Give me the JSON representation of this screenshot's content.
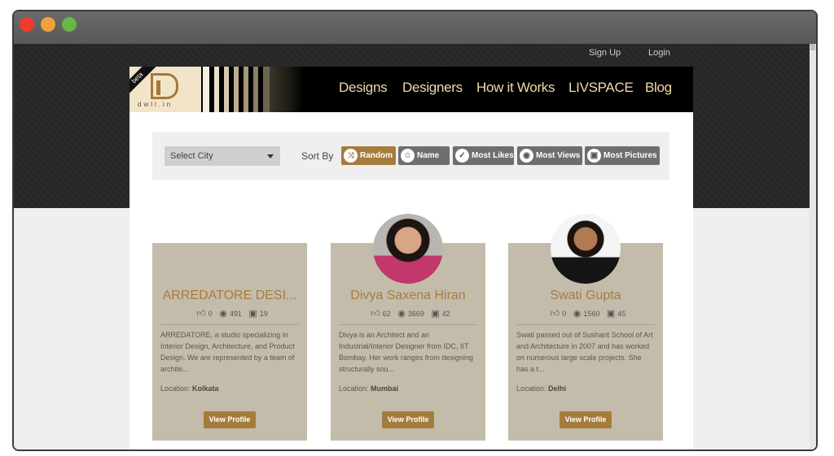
{
  "window": {
    "controls": [
      "close",
      "minimize",
      "maximize"
    ]
  },
  "topnav": {
    "signup": "Sign Up",
    "login": "Login"
  },
  "logo": {
    "badge": "beta",
    "name": "dwll.in"
  },
  "mainnav": [
    "Designs",
    "Designers",
    "How it Works",
    "LIVSPACE",
    "Blog"
  ],
  "filters": {
    "city_select": "Select City",
    "sort_label": "Sort By",
    "sort_options": [
      {
        "label": "Random",
        "icon": "shuffle-icon",
        "active": true
      },
      {
        "label": "Name",
        "icon": "people-icon",
        "active": false
      },
      {
        "label": "Most Likes",
        "icon": "thumbs-up-icon",
        "active": false
      },
      {
        "label": "Most Views",
        "icon": "eye-icon",
        "active": false
      },
      {
        "label": "Most Pictures",
        "icon": "pictures-icon",
        "active": false
      }
    ]
  },
  "designers": [
    {
      "name": "ARREDATORE DESI...",
      "likes": "0",
      "views": "491",
      "pictures": "19",
      "description": "ARREDATORE, a studio specializing in Interior Design, Architecture, and Product Design. We are represented by a team of archite...",
      "location_label": "Location:",
      "location": "Kolkata",
      "button": "View Profile",
      "has_avatar": false
    },
    {
      "name": "Divya Saxena Hiran",
      "likes": "62",
      "views": "3669",
      "pictures": "42",
      "description": "Divya is an Architect and an Industrial/Interior Designer from IDC, IIT Bombay. Her work ranges from designing structurally sou...",
      "location_label": "Location:",
      "location": "Mumbai",
      "button": "View Profile",
      "has_avatar": true
    },
    {
      "name": "Swati Gupta",
      "likes": "0",
      "views": "1560",
      "pictures": "45",
      "description": "Swati passed out of Sushant School of Art and Architecture in 2007 and has worked on numerous large scale projects. She has a t...",
      "location_label": "Location:",
      "location": "Delhi",
      "button": "View Profile",
      "has_avatar": true
    }
  ],
  "colors": {
    "accent": "#a67c3d",
    "card": "#c3bcab",
    "nav_text": "#f1d9a8"
  }
}
